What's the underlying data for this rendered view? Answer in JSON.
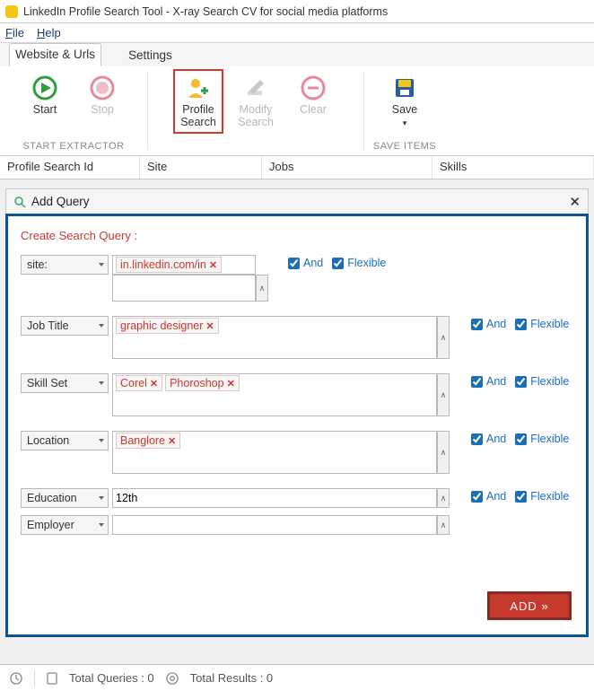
{
  "window": {
    "title": "LinkedIn Profile Search Tool - X-ray Search CV for social media platforms"
  },
  "menu": {
    "file": "File",
    "help": "Help"
  },
  "tabs": {
    "websiteUrls": "Website & Urls",
    "settings": "Settings"
  },
  "ribbon": {
    "start": "Start",
    "stop": "Stop",
    "profileSearch": "Profile\nSearch",
    "modifySearch": "Modify\nSearch",
    "clear": "Clear",
    "save": "Save",
    "group_start": "START EXTRACTOR",
    "group_save": "SAVE ITEMS"
  },
  "grid": {
    "cols": {
      "id": "Profile Search Id",
      "site": "Site",
      "jobs": "Jobs",
      "skills": "Skills"
    }
  },
  "dialog": {
    "title": "Add Query",
    "legend": "Create Search Query :",
    "labels": {
      "site": "site:",
      "jobTitle": "Job Title",
      "skillSet": "Skill Set",
      "location": "Location",
      "education": "Education",
      "employer": "Employer"
    },
    "values": {
      "site_chip": "in.linkedin.com/in",
      "jobTitle_chips": [
        "graphic designer"
      ],
      "skill_chips": [
        "Corel",
        "Phoroshop"
      ],
      "location_chips": [
        "Banglore"
      ],
      "education_value": "12th",
      "employer_value": ""
    },
    "options": {
      "and": "And",
      "flexible": "Flexible"
    },
    "addBtn": "ADD »"
  },
  "status": {
    "queries": "Total Queries : 0",
    "results": "Total Results : 0"
  }
}
